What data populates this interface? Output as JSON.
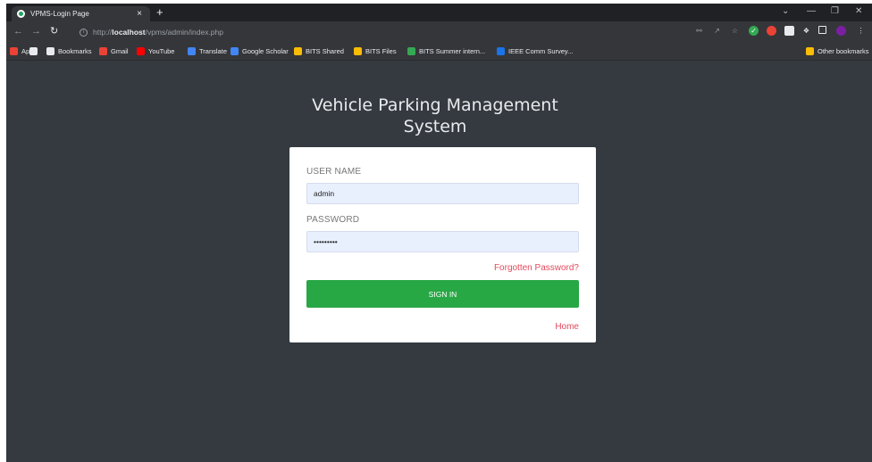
{
  "browser": {
    "tab_title": "VPMS-Login Page",
    "tab_close": "×",
    "new_tab": "+",
    "url_scheme": "http://",
    "url_host": "localhost",
    "url_path": "/vpms/admin/index.php",
    "window_controls": {
      "dropdown": "⌄",
      "minimize": "—",
      "restore": "❐",
      "close": "✕"
    }
  },
  "bookmarks": [
    {
      "label": "Apps",
      "icon": "apps-grid-icon",
      "color": "#ea4335"
    },
    {
      "label": "",
      "icon": "chrome-icon",
      "color": "#e8eaed"
    },
    {
      "label": "Bookmarks",
      "icon": "star-icon",
      "color": "#e8eaed"
    },
    {
      "label": "Gmail",
      "icon": "gmail-icon",
      "color": "#ea4335"
    },
    {
      "label": "YouTube",
      "icon": "youtube-icon",
      "color": "#ff0000"
    },
    {
      "label": "Translate",
      "icon": "translate-icon",
      "color": "#4285f4"
    },
    {
      "label": "Google Scholar",
      "icon": "scholar-icon",
      "color": "#4285f4"
    },
    {
      "label": "BITS Shared",
      "icon": "drive-icon",
      "color": "#fbbc04"
    },
    {
      "label": "BITS Files",
      "icon": "drive-icon",
      "color": "#fbbc04"
    },
    {
      "label": "BITS Summer intern...",
      "icon": "sprout-icon",
      "color": "#34a853"
    },
    {
      "label": "IEEE Comm Survey...",
      "icon": "ieee-icon",
      "color": "#1a73e8"
    }
  ],
  "other_bookmarks": "Other bookmarks",
  "page": {
    "title": "Vehicle Parking Management System",
    "username_label": "USER NAME",
    "username_value": "admin",
    "password_label": "PASSWORD",
    "password_value": "•••••••••",
    "forgot_link": "Forgotten Password?",
    "signin_label": "SIGN IN",
    "home_link": "Home"
  },
  "colors": {
    "page_bg": "#343a40",
    "button_green": "#28a745",
    "link_red": "#e34a5c",
    "input_bg": "#e8f0fe"
  }
}
